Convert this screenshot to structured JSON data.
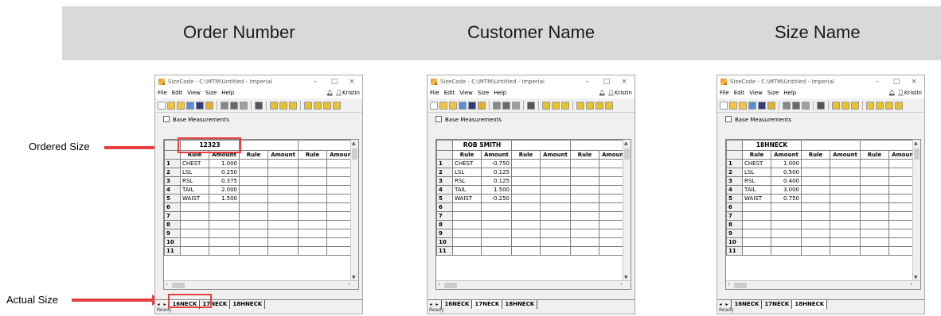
{
  "headers": [
    "Order Number",
    "Customer Name",
    "Size Name"
  ],
  "callouts": {
    "ordered_size": "Ordered Size",
    "actual_size": "Actual Size"
  },
  "accent_color": "#e84040",
  "window": {
    "title": "SizeCode - C:\\MTM\\Untitled - Imperial",
    "menu": [
      "File",
      "Edit",
      "View",
      "Size",
      "Help"
    ],
    "user": "Kristin",
    "base_measurements_label": "Base Measurements",
    "status": "Ready",
    "tabs": [
      "16NECK",
      "17NECK",
      "18HNECK"
    ],
    "column_headers": [
      "Rule",
      "Amount",
      "Rule",
      "Amount",
      "Rule",
      "Amount"
    ],
    "row_numbers": [
      "1",
      "2",
      "3",
      "4",
      "5",
      "6",
      "7",
      "8",
      "9",
      "10",
      "11"
    ]
  },
  "windows": [
    {
      "size_header": "12323",
      "active_tab": 0,
      "rows": [
        {
          "rule": "CHEST",
          "amount": "1.000"
        },
        {
          "rule": "LSL",
          "amount": "0.250"
        },
        {
          "rule": "RSL",
          "amount": "0.375"
        },
        {
          "rule": "TAIL",
          "amount": "2.000"
        },
        {
          "rule": "WAIST",
          "amount": "1.500"
        }
      ]
    },
    {
      "size_header": "ROB SMITH",
      "active_tab": 1,
      "rows": [
        {
          "rule": "CHEST",
          "amount": "-0.750"
        },
        {
          "rule": "LSL",
          "amount": "0.125"
        },
        {
          "rule": "RSL",
          "amount": "0.125"
        },
        {
          "rule": "TAIL",
          "amount": "1.500"
        },
        {
          "rule": "WAIST",
          "amount": "-0.250"
        }
      ]
    },
    {
      "size_header": "18HNECK",
      "active_tab": 2,
      "rows": [
        {
          "rule": "CHEST",
          "amount": "1.000"
        },
        {
          "rule": "LSL",
          "amount": "0.500"
        },
        {
          "rule": "RSL",
          "amount": "0.400"
        },
        {
          "rule": "TAIL",
          "amount": "3.000"
        },
        {
          "rule": "WAIST",
          "amount": "0.750"
        }
      ]
    }
  ]
}
